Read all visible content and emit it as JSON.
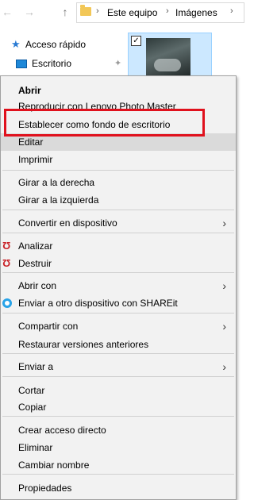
{
  "explorer": {
    "breadcrumb": [
      "Este equipo",
      "Imágenes"
    ],
    "breadcrumb_sep": "›",
    "sidebar": [
      {
        "label": "Acceso rápido",
        "icon": "star-icon"
      },
      {
        "label": "Escritorio",
        "icon": "desktop-icon"
      }
    ],
    "icons": {
      "back": "←",
      "forward": "→",
      "up": "↑",
      "pin": "✦",
      "check": "✓"
    }
  },
  "menu": {
    "items": [
      {
        "label": "Abrir",
        "bold": true
      },
      {
        "label": "Reproducir con Lenovo Photo Master"
      },
      {
        "label": "Establecer como fondo de escritorio"
      },
      {
        "label": "Editar"
      },
      {
        "label": "Imprimir"
      },
      {
        "label": "Girar a la derecha"
      },
      {
        "label": "Girar a la izquierda"
      },
      {
        "label": "Convertir en dispositivo",
        "submenu": true
      },
      {
        "label": "Analizar",
        "icon": "shield-icon"
      },
      {
        "label": "Destruir",
        "icon": "shield-icon"
      },
      {
        "label": "Abrir con",
        "submenu": true
      },
      {
        "label": "Enviar a otro dispositivo con SHAREit",
        "icon": "shareit-icon"
      },
      {
        "label": "Compartir con",
        "submenu": true
      },
      {
        "label": "Restaurar versiones anteriores"
      },
      {
        "label": "Enviar a",
        "submenu": true
      },
      {
        "label": "Cortar"
      },
      {
        "label": "Copiar"
      },
      {
        "label": "Crear acceso directo"
      },
      {
        "label": "Eliminar"
      },
      {
        "label": "Cambiar nombre"
      },
      {
        "label": "Propiedades"
      }
    ],
    "arrow": "›",
    "shield_glyph": "Ʊ",
    "highlight_color": "#e0111d"
  }
}
